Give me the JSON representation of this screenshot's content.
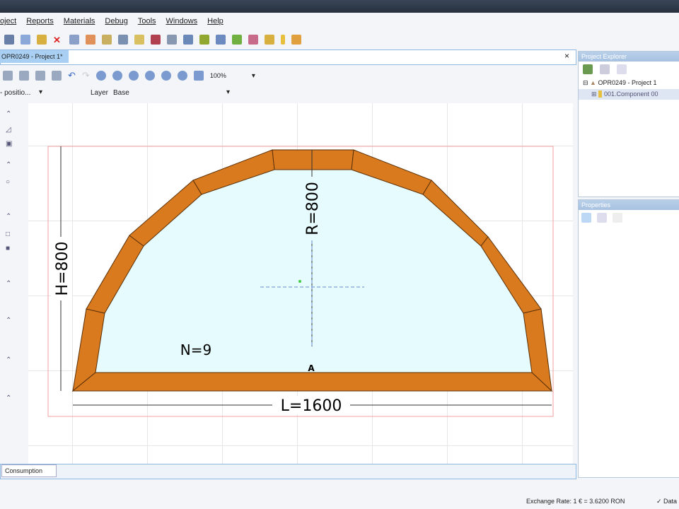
{
  "menu": [
    "oject",
    "Reports",
    "Materials",
    "Debug",
    "Tools",
    "Windows",
    "Help"
  ],
  "document_tab": "OPR0249 - Project 1*",
  "close_symbol": "×",
  "zoom_level": "100%",
  "position_select": "- positio...",
  "layer_label": "Layer",
  "layer_value": "Base",
  "drawing": {
    "height_label": "H=800",
    "radius_label": "R=800",
    "length_label": "L=1600",
    "segments_label": "N=9",
    "point_label": "A",
    "frame_color": "#d97a1e",
    "glass_color": "#e6fbfd"
  },
  "consumption_tab": "Consumption",
  "project_explorer": {
    "title": "Project Explorer",
    "project": "OPR0249 - Project 1",
    "component": "001.Component 00"
  },
  "properties": {
    "title": "Properties"
  },
  "status": {
    "exchange_rate": "Exchange Rate: 1 € = 3.6200 RON",
    "data": "✓ Data"
  }
}
